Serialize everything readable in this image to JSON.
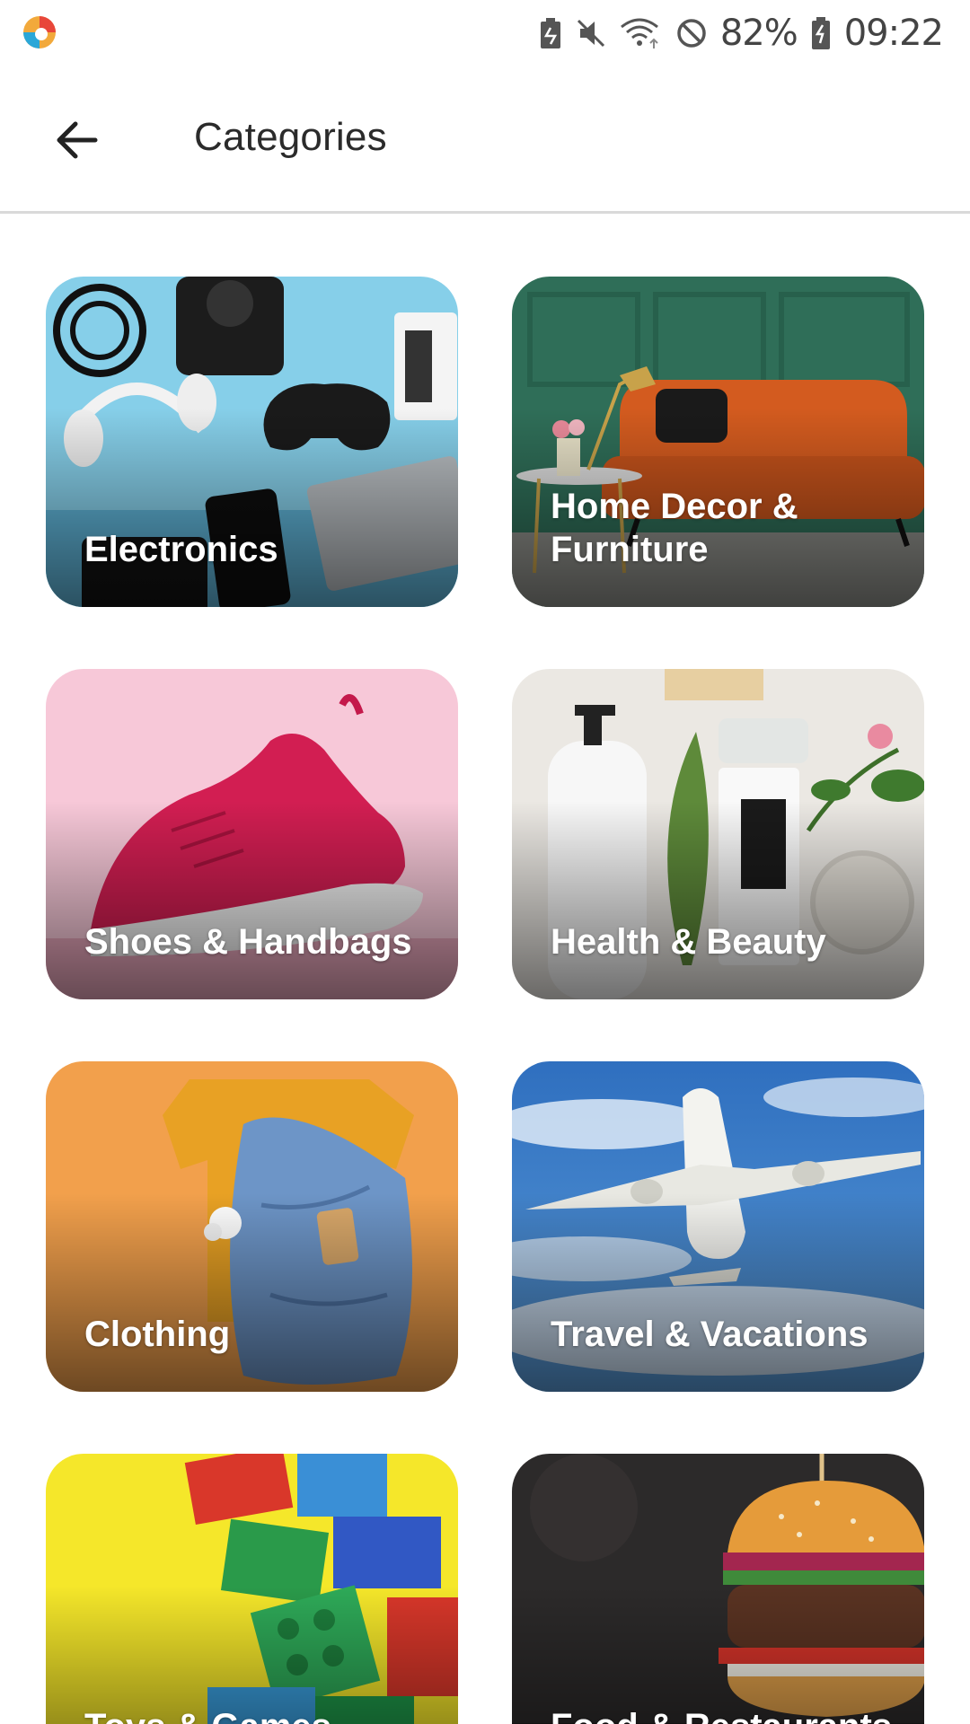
{
  "status_bar": {
    "battery_percent": "82%",
    "time": "09:22",
    "icons": [
      "app-logo-icon",
      "battery-saver-icon",
      "mute-icon",
      "wifi-icon",
      "do-not-disturb-icon",
      "battery-icon"
    ]
  },
  "header": {
    "title": "Categories",
    "back_icon": "arrow-left-icon"
  },
  "categories": [
    {
      "label": "Electronics"
    },
    {
      "label": "Home Decor & Furniture"
    },
    {
      "label": "Shoes & Handbags"
    },
    {
      "label": "Health & Beauty"
    },
    {
      "label": "Clothing"
    },
    {
      "label": "Travel & Vacations"
    },
    {
      "label": "Toys & Games"
    },
    {
      "label": "Food & Restaurants"
    }
  ],
  "colors": {
    "electronics_bg": "#7cc9e6",
    "home_decor_bg": "#2d6b55",
    "shoes_bg": "#f6c6d6",
    "health_bg": "#e9e6e0",
    "clothing_bg": "#f2a04c",
    "travel_bg": "#3a7cc4",
    "toys_bg": "#f4e92a",
    "food_bg": "#2c2a2a"
  }
}
